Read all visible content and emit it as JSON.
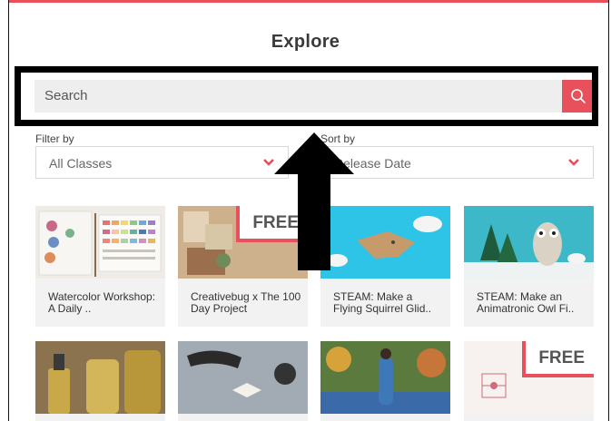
{
  "header": {
    "title": "Explore"
  },
  "search": {
    "placeholder": "Search"
  },
  "filters": {
    "filter_label": "Filter by",
    "filter_value": "All Classes",
    "sort_label": "Sort by",
    "sort_value": "Release Date"
  },
  "classes": [
    {
      "title": "Watercolor Workshop: A Daily ..",
      "free": false
    },
    {
      "title": "Creativebug x The 100 Day Project",
      "free": true,
      "free_label": "FREE"
    },
    {
      "title": "STEAM: Make a Flying Squirrel Glid..",
      "free": false
    },
    {
      "title": "STEAM: Make an Animatronic Owl Fi..",
      "free": false
    },
    {
      "title": "",
      "free": false
    },
    {
      "title": "",
      "free": false
    },
    {
      "title": "",
      "free": false
    },
    {
      "title": "",
      "free": true,
      "free_label": "FREE"
    }
  ],
  "colors": {
    "accent": "#e8505b",
    "search_bg": "#eeeeee",
    "card_bg": "#f2f2f2",
    "annotation": "#000000"
  },
  "icons": {
    "search": "search-icon",
    "chevron": "chevron-down-icon",
    "annotation": "up-arrow-icon"
  }
}
